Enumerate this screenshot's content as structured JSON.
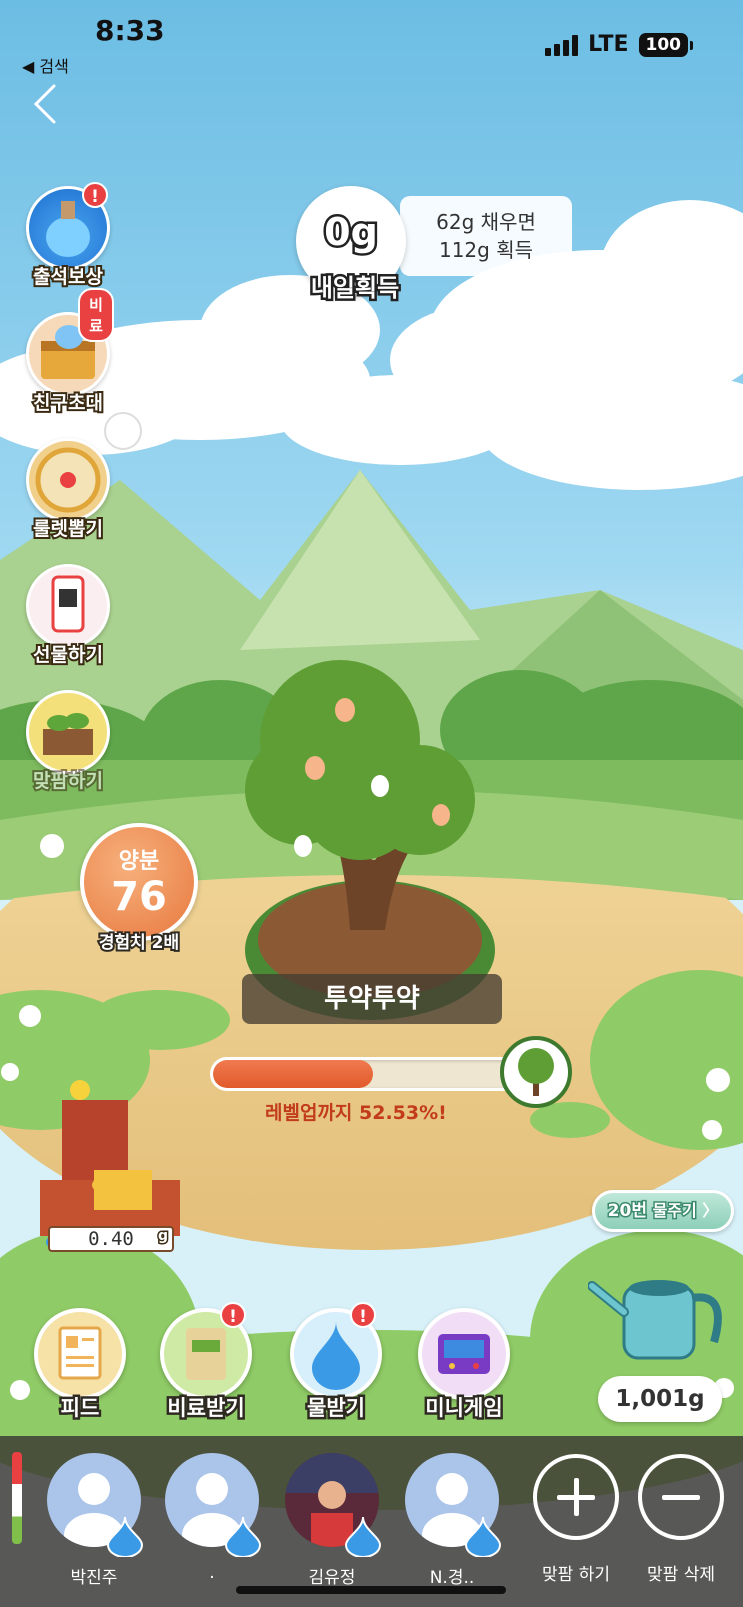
{
  "status_bar": {
    "time": "8:33",
    "back_app": "◀ 검색",
    "network": "LTE",
    "battery": "100"
  },
  "left_menu": [
    {
      "label": "출석보상",
      "badge": "!"
    },
    {
      "label": "친구초대",
      "badge": "비료"
    },
    {
      "label": "룰렛뽑기",
      "badge": ""
    },
    {
      "label": "선물하기",
      "badge": ""
    },
    {
      "label": "맞팜하기",
      "badge": ""
    }
  ],
  "tomorrow": {
    "value": "0g",
    "label": "내일획득",
    "bubble_line1": "62g 채우면",
    "bubble_line2": "112g 획득"
  },
  "nutrient": {
    "label": "양분",
    "value": "76",
    "sub": "경험치 2배"
  },
  "tree": {
    "name": "투약투약"
  },
  "progress": {
    "text": "레벨업까지 52.53%!",
    "percent": 52.53
  },
  "water_meter": {
    "value": "0.40",
    "unit": "g"
  },
  "water_times": {
    "count": "20번",
    "label": "물주기",
    "chevron": "〉"
  },
  "watering_can": {
    "amount": "1,001g"
  },
  "actions": [
    {
      "label": "피드",
      "badge": ""
    },
    {
      "label": "비료받기",
      "badge": "!"
    },
    {
      "label": "물받기",
      "badge": "!"
    },
    {
      "label": "미니게임",
      "badge": ""
    }
  ],
  "friends": [
    {
      "name": "박진주"
    },
    {
      "name": "."
    },
    {
      "name": "김유정"
    },
    {
      "name": "N.경.."
    }
  ],
  "friend_actions": {
    "add": "맞팜 하기",
    "remove": "맞팜 삭제"
  },
  "colors": {
    "sky": "#7cc4e6",
    "progress": "#e15a2b",
    "nutrient": "#e7793f",
    "badge": "#e94141"
  }
}
